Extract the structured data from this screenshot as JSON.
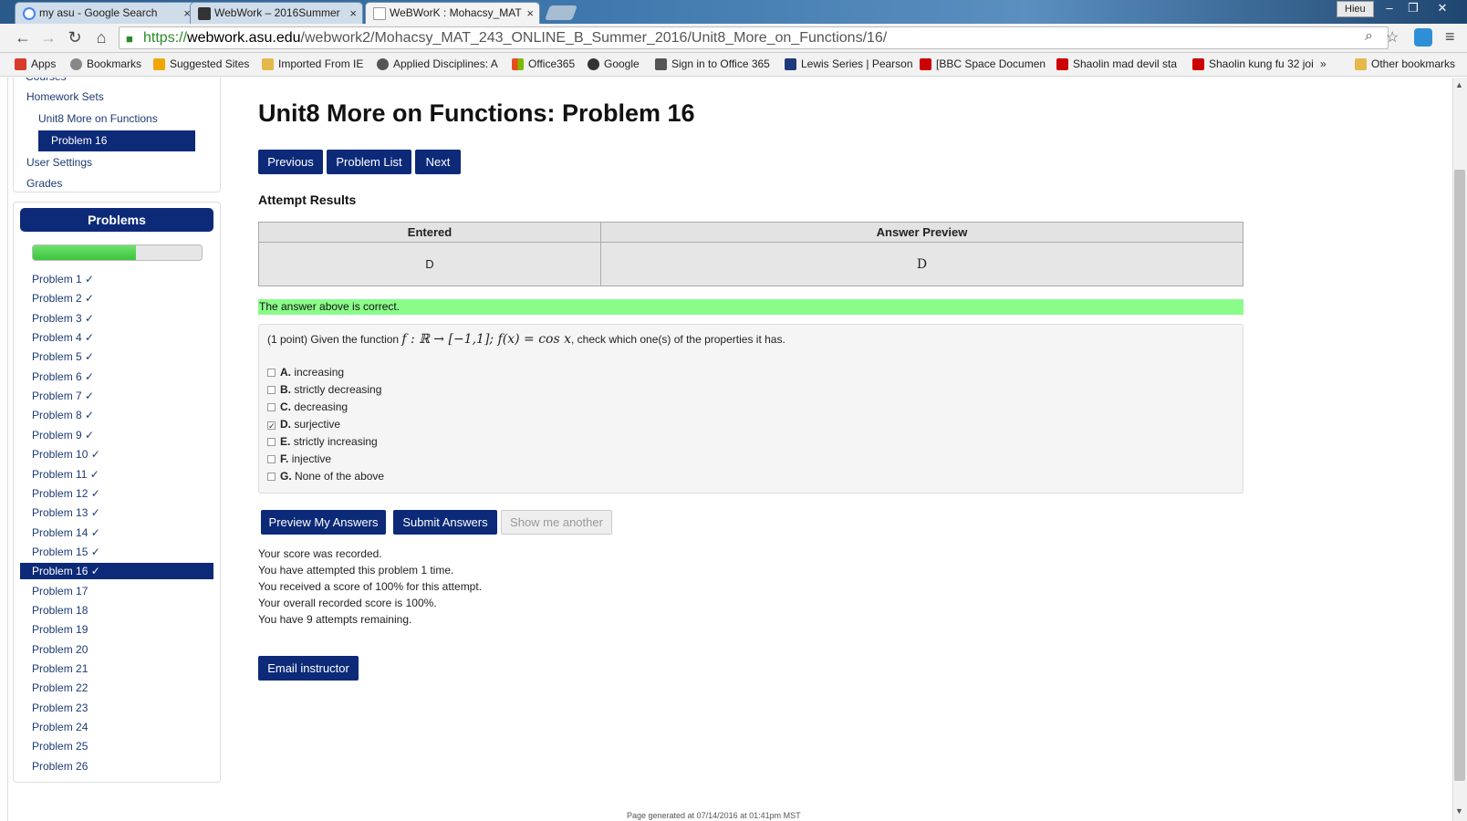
{
  "browser": {
    "tabs": [
      {
        "title": "my asu - Google Search",
        "close": "×"
      },
      {
        "title": "WebWork – 2016Summer",
        "close": "×"
      },
      {
        "title": "WeBWorK : Mohacsy_MAT",
        "close": "×"
      }
    ],
    "user": "Hieu",
    "window_buttons": [
      "–",
      "❐",
      "✕"
    ],
    "url": {
      "scheme": "https://",
      "host": "webwork.asu.edu",
      "path": "/webwork2/Mohacsy_MAT_243_ONLINE_B_Summer_2016/Unit8_More_on_Functions/16/"
    },
    "bookmarks": [
      {
        "label": "Apps",
        "icon": "apps-grid-icon",
        "color": "#d83b2b"
      },
      {
        "label": "Bookmarks",
        "icon": "star-icon",
        "color": "#888888"
      },
      {
        "label": "Suggested Sites",
        "icon": "suggested-sites-icon",
        "color": "#f0a800"
      },
      {
        "label": "Imported From IE",
        "icon": "folder-icon",
        "color": "#e5b84a"
      },
      {
        "label": "Applied Disciplines: A",
        "icon": "site-icon",
        "color": "#555555"
      },
      {
        "label": "Office365",
        "icon": "windows-icon",
        "color": "#e84c1c"
      },
      {
        "label": "Google",
        "icon": "google-icon",
        "color": "#333333"
      },
      {
        "label": "Sign in to Office 365",
        "icon": "doc-icon",
        "color": "#555555"
      },
      {
        "label": "Lewis Series | Pearson",
        "icon": "pearson-icon",
        "color": "#1f3a7a"
      },
      {
        "label": "[BBC Space Documen",
        "icon": "youtube-icon",
        "color": "#cc0000"
      },
      {
        "label": "Shaolin mad devil sta",
        "icon": "youtube-icon",
        "color": "#cc0000"
      },
      {
        "label": "Shaolin kung fu 32 joi",
        "icon": "youtube-icon",
        "color": "#cc0000"
      },
      {
        "label": "»",
        "icon": "more-icon",
        "color": "#f2f2f2"
      },
      {
        "label": "Other bookmarks",
        "icon": "folder-icon",
        "color": "#e5b84a"
      }
    ]
  },
  "sidebar": {
    "courses": "Courses",
    "homework_sets": "Homework Sets",
    "set_name": "Unit8 More on Functions",
    "current_problem": "Problem 16",
    "user_settings": "User Settings",
    "grades": "Grades",
    "problems_title": "Problems",
    "progress_fraction": 0.61,
    "problems": [
      "Problem 1 ✓",
      "Problem 2 ✓",
      "Problem 3 ✓",
      "Problem 4 ✓",
      "Problem 5 ✓",
      "Problem 6 ✓",
      "Problem 7 ✓",
      "Problem 8 ✓",
      "Problem 9 ✓",
      "Problem 10 ✓",
      "Problem 11 ✓",
      "Problem 12 ✓",
      "Problem 13 ✓",
      "Problem 14 ✓",
      "Problem 15 ✓",
      "Problem 16 ✓",
      "Problem 17",
      "Problem 18",
      "Problem 19",
      "Problem 20",
      "Problem 21",
      "Problem 22",
      "Problem 23",
      "Problem 24",
      "Problem 25",
      "Problem 26"
    ]
  },
  "main": {
    "title": "Unit8 More on Functions: Problem 16",
    "nav_buttons": {
      "previous": "Previous",
      "problem_list": "Problem List",
      "next": "Next"
    },
    "attempt_results_label": "Attempt Results",
    "results": {
      "header_entered": "Entered",
      "header_preview": "Answer Preview",
      "entered": "D",
      "preview": "D"
    },
    "correct_message": "The answer above is correct.",
    "problem": {
      "prefix": "(1 point) Given the function ",
      "math": "f : ℝ → [−1,1]; f(x) = cos x",
      "suffix": ", check which one(s) of the properties it has."
    },
    "choices": [
      {
        "letter": "A.",
        "text": "increasing",
        "checked": false
      },
      {
        "letter": "B.",
        "text": "strictly decreasing",
        "checked": false
      },
      {
        "letter": "C.",
        "text": "decreasing",
        "checked": false
      },
      {
        "letter": "D.",
        "text": "surjective",
        "checked": true
      },
      {
        "letter": "E.",
        "text": "strictly increasing",
        "checked": false
      },
      {
        "letter": "F.",
        "text": "injective",
        "checked": false
      },
      {
        "letter": "G.",
        "text": "None of the above",
        "checked": false
      }
    ],
    "action_buttons": {
      "preview": "Preview My Answers",
      "submit": "Submit Answers",
      "show_another": "Show me another"
    },
    "score_lines": [
      "Your score was recorded.",
      "You have attempted this problem 1 time.",
      "You received a score of 100% for this attempt.",
      "Your overall recorded score is 100%.",
      "You have 9 attempts remaining."
    ],
    "email_instructor": "Email instructor",
    "footer": "Page generated at 07/14/2016 at 01:41pm MST"
  },
  "colors": {
    "navy": "#0c2a78",
    "correct_green": "#8afc8a",
    "progress_green": "#3cc43c"
  }
}
